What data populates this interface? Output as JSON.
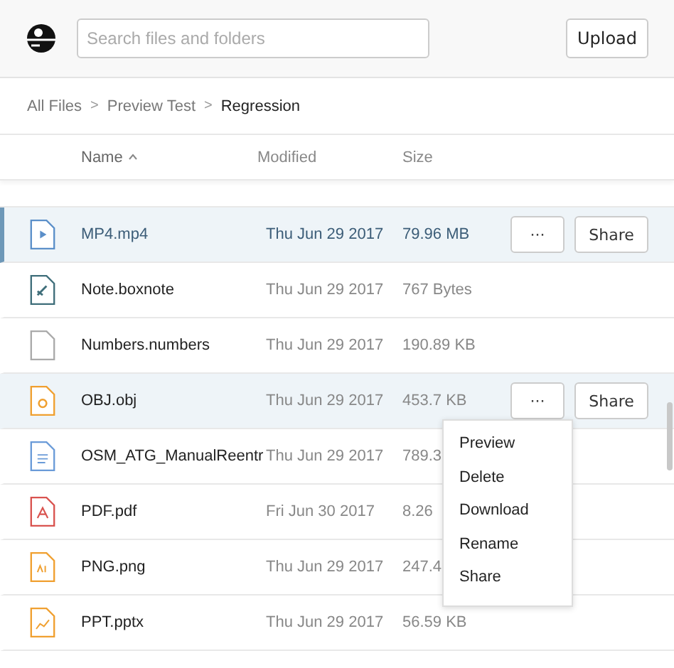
{
  "header": {
    "search": {
      "placeholder": "Search files and folders"
    },
    "upload_button": "Upload"
  },
  "breadcrumbs": [
    {
      "label": "All Files",
      "current": false
    },
    {
      "separator": ">",
      "label": "Preview Test",
      "current": false
    },
    {
      "separator": ">",
      "label": "Regression",
      "current": true
    }
  ],
  "columns": [
    {
      "label": "Name",
      "sorted": true
    },
    {
      "label": "Modified",
      "sorted": false
    },
    {
      "label": "Size",
      "sorted": false
    }
  ],
  "rows": [
    {
      "name": "MP4.mp4",
      "modified": "Thu Jun 29 2017",
      "size": "79.96 MB",
      "kind": "video",
      "selected": true,
      "hovered": false,
      "actions": {
        "more": "···",
        "share": "Share"
      }
    },
    {
      "name": "Note.boxnote",
      "modified": "Thu Jun 29 2017",
      "size": "767 Bytes",
      "kind": "note",
      "selected": false,
      "hovered": false
    },
    {
      "name": "Numbers.numbers",
      "modified": "Thu Jun 29 2017",
      "size": "190.89 KB",
      "kind": "blank",
      "selected": false,
      "hovered": false
    },
    {
      "name": "OBJ.obj",
      "modified": "Thu Jun 29 2017",
      "size": "453.7 KB",
      "kind": "obj",
      "selected": false,
      "hovered": true,
      "actions": {
        "more": "···",
        "share": "Share"
      }
    },
    {
      "name": "OSM_ATG_ManualReentr",
      "modified": "Thu Jun 29 2017",
      "size": "789.3",
      "kind": "doc",
      "selected": false,
      "hovered": false
    },
    {
      "name": "PDF.pdf",
      "modified": "Fri Jun 30 2017",
      "size": "8.26",
      "kind": "pdf",
      "selected": false,
      "hovered": false
    },
    {
      "name": "PNG.png",
      "modified": "Thu Jun 29 2017",
      "size": "247.4",
      "kind": "ai",
      "selected": false,
      "hovered": false
    },
    {
      "name": "PPT.pptx",
      "modified": "Thu Jun 29 2017",
      "size": "56.59 KB",
      "kind": "ppt",
      "selected": false,
      "hovered": false
    }
  ],
  "context_menu": [
    "Preview",
    "Delete",
    "Download",
    "Rename",
    "Share"
  ]
}
